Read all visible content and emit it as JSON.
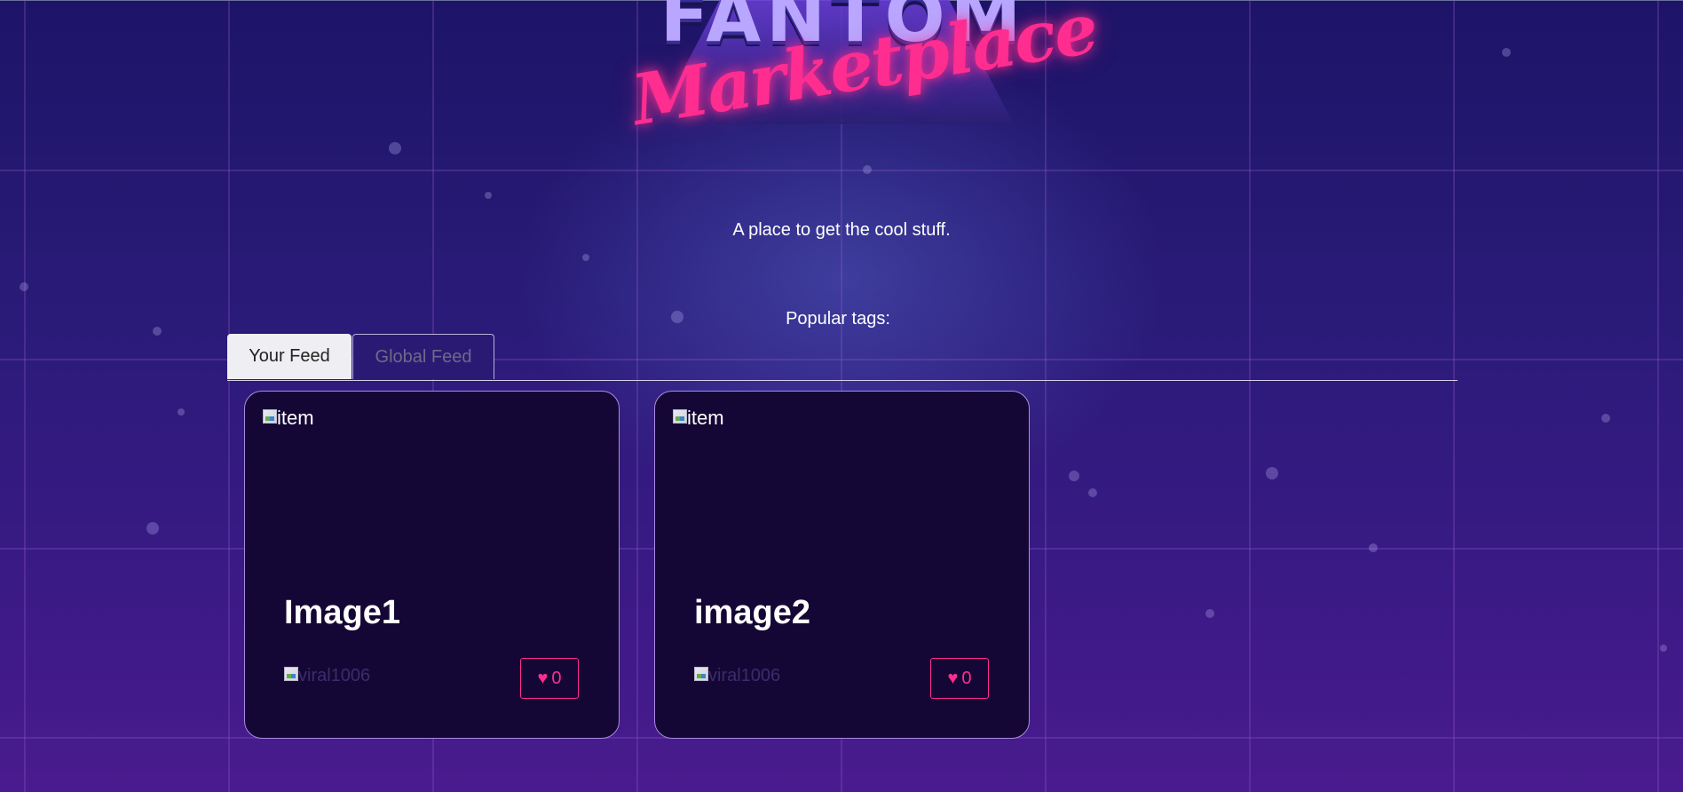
{
  "banner": {
    "chrome_text": "FANTOM",
    "script_text": "Marketplace"
  },
  "tagline": "A place to get the cool stuff.",
  "popular_tags_label": "Popular tags:",
  "tabs": [
    {
      "label": "Your Feed",
      "active": true
    },
    {
      "label": "Global Feed",
      "active": false
    }
  ],
  "items": [
    {
      "image_alt": "item",
      "title": "Image1",
      "author_alt": "viral1006",
      "likes": "0"
    },
    {
      "image_alt": "item",
      "title": "image2",
      "author_alt": "viral1006",
      "likes": "0"
    }
  ],
  "colors": {
    "accent": "#ff2d8f",
    "card_bg": "#150735",
    "card_border": "#a88be0"
  },
  "icons": {
    "like": "heart-icon",
    "broken_image": "broken-image-icon"
  }
}
